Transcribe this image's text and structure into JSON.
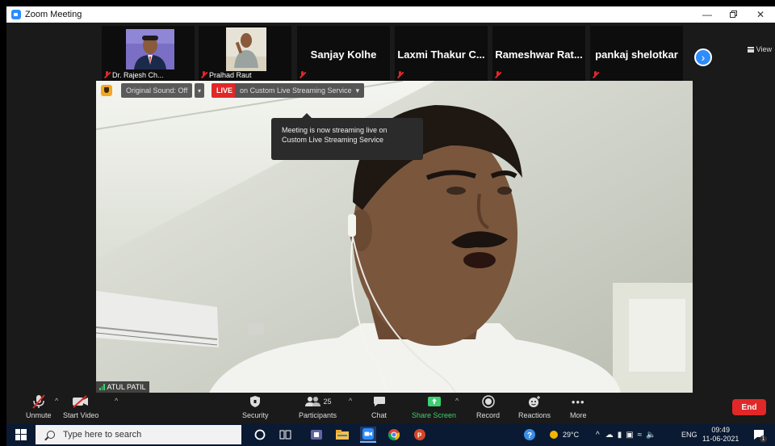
{
  "window": {
    "title": "Zoom Meeting"
  },
  "participants": [
    {
      "name": "Dr. Rajesh Ch...",
      "type": "photo"
    },
    {
      "name": "Pralhad Raut",
      "type": "photo"
    },
    {
      "name": "Sanjay Kolhe",
      "type": "name"
    },
    {
      "name": "Laxmi Thakur C...",
      "type": "name"
    },
    {
      "name": "Rameshwar Rat...",
      "type": "name"
    },
    {
      "name": "pankaj shelotkar",
      "type": "name"
    }
  ],
  "view_label": "View",
  "video": {
    "original_sound": "Original Sound: Off",
    "live": "LIVE",
    "live_service": "on Custom Live Streaming Service",
    "tooltip": "Meeting is now streaming live on Custom Live Streaming Service",
    "speaker": "ATUL PATIL"
  },
  "toolbar": {
    "unmute": "Unmute",
    "start_video": "Start Video",
    "security": "Security",
    "participants": "Participants",
    "participant_count": "25",
    "chat": "Chat",
    "share_screen": "Share Screen",
    "record": "Record",
    "reactions": "Reactions",
    "more": "More",
    "end": "End"
  },
  "taskbar": {
    "search_placeholder": "Type here to search",
    "temperature": "29°C",
    "language": "ENG",
    "time": "09:49",
    "date": "11-06-2021",
    "notification_count": "1"
  },
  "colors": {
    "zoom_blue": "#2d8cff",
    "live_red": "#e02828",
    "toolbar_bg": "#1a1a1a",
    "share_green": "#3cd070"
  }
}
